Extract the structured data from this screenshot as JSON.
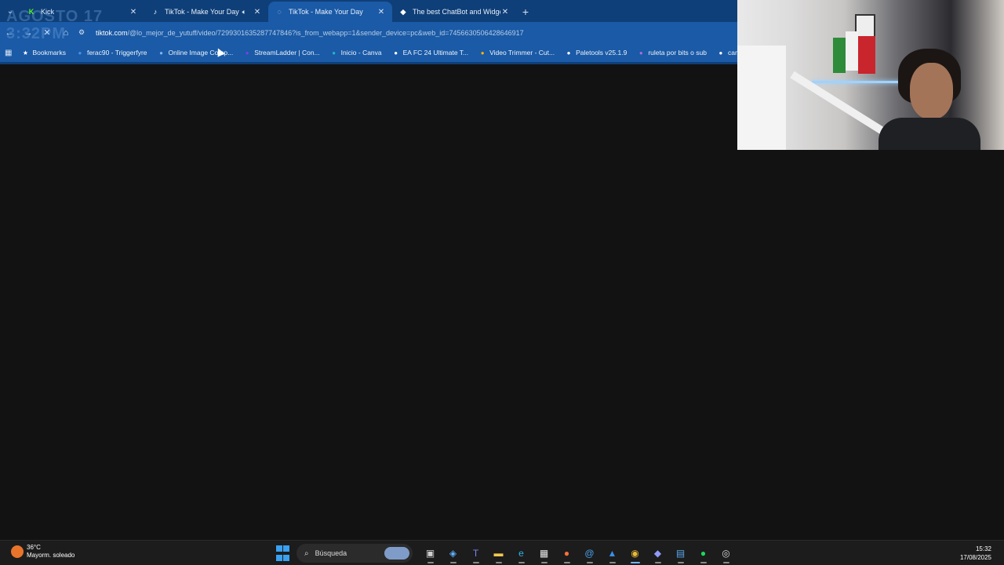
{
  "watermark": {
    "line1": "AGOSTO 17",
    "line2": "3:32PM"
  },
  "tabs": [
    {
      "title": "Kick",
      "icon": "kick-icon",
      "icon_color": "#53fc18",
      "active": false
    },
    {
      "title": "TikTok - Make Your Day",
      "icon": "tiktok-icon",
      "icon_color": "#ffffff",
      "active": false,
      "audio": true
    },
    {
      "title": "TikTok - Make Your Day",
      "icon": "loading-icon",
      "icon_color": "#cfe0f5",
      "active": true
    },
    {
      "title": "The best ChatBot and Widgets",
      "icon": "streamelements-icon",
      "icon_color": "#ffffff",
      "active": false
    }
  ],
  "address": {
    "host": "tiktok.com",
    "path": "/@lo_mejor_de_yutuff/video/7299301635287747846?is_from_webapp=1&sender_device=pc&web_id=7456630506428646917"
  },
  "bookmarks": [
    {
      "label": "Bookmarks",
      "icon": "star-icon",
      "color": "#ffffff"
    },
    {
      "label": "ferac90 - Triggerfyre",
      "icon": "triggerfyre-icon",
      "color": "#4a90e2"
    },
    {
      "label": "Online Image Comp...",
      "icon": "image-compressor-icon",
      "color": "#7fb2f0"
    },
    {
      "label": "StreamLadder | Con...",
      "icon": "streamladder-icon",
      "color": "#7b3fe4"
    },
    {
      "label": "Inicio - Canva",
      "icon": "canva-icon",
      "color": "#21b5c9"
    },
    {
      "label": "EA FC 24 Ultimate T...",
      "icon": "futbin-icon",
      "color": "#ffffff"
    },
    {
      "label": "Video Trimmer - Cut...",
      "icon": "video-trimmer-icon",
      "color": "#f4b400"
    },
    {
      "label": "Paletools v25.1.9",
      "icon": "paletools-icon",
      "color": "#ffffff"
    },
    {
      "label": "ruleta por bits o sub",
      "icon": "ruleta-icon",
      "color": "#b06ad9"
    },
    {
      "label": "camara cel",
      "icon": "camera-icon",
      "color": "#ffffff"
    }
  ],
  "taskbar": {
    "weather_temp": "36°C",
    "weather_desc": "Mayorm. soleado",
    "search_placeholder": "Búsqueda",
    "apps": [
      {
        "name": "task-view-icon",
        "glyph": "▣",
        "color": "#d0d0d0"
      },
      {
        "name": "copilot-icon",
        "glyph": "◈",
        "color": "#5fb3ff"
      },
      {
        "name": "teams-icon",
        "glyph": "T",
        "color": "#7b83eb"
      },
      {
        "name": "file-explorer-icon",
        "glyph": "▬",
        "color": "#f2c94c"
      },
      {
        "name": "edge-icon",
        "glyph": "e",
        "color": "#2fb2e6"
      },
      {
        "name": "store-icon",
        "glyph": "▦",
        "color": "#e8e8e8"
      },
      {
        "name": "firefox-icon",
        "glyph": "●",
        "color": "#ff7139"
      },
      {
        "name": "mail-icon",
        "glyph": "@",
        "color": "#4aa3f0"
      },
      {
        "name": "photos-icon",
        "glyph": "▲",
        "color": "#3a8ee6"
      },
      {
        "name": "chrome-icon",
        "glyph": "◉",
        "color": "#e8b93a",
        "active": true
      },
      {
        "name": "discord-icon",
        "glyph": "◆",
        "color": "#8f9bf7"
      },
      {
        "name": "notepad-icon",
        "glyph": "▤",
        "color": "#5aa9f0"
      },
      {
        "name": "spotify-icon",
        "glyph": "●",
        "color": "#1ed760"
      },
      {
        "name": "obs-icon",
        "glyph": "◎",
        "color": "#d8d8d8"
      }
    ],
    "time": "15:32",
    "date": "17/08/2025"
  }
}
